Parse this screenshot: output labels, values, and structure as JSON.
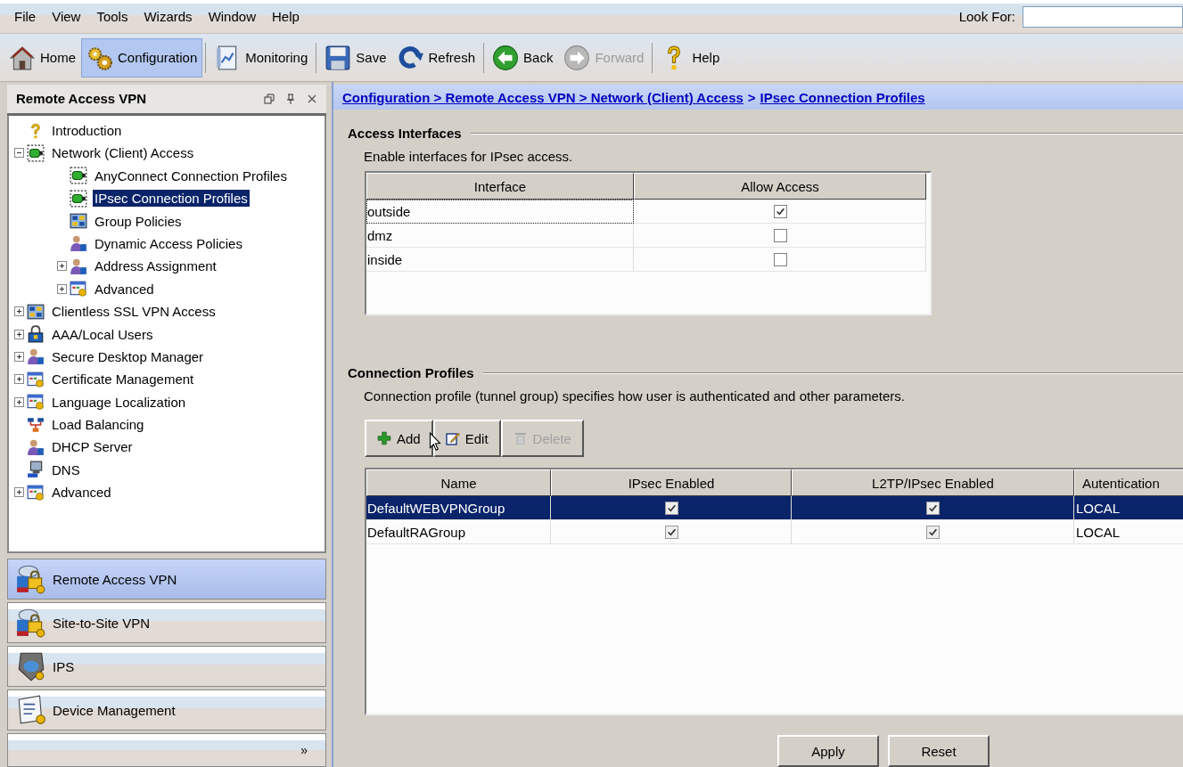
{
  "menu_bar": {
    "items": [
      "File",
      "View",
      "Tools",
      "Wizards",
      "Window",
      "Help"
    ],
    "look_for": {
      "label": "Look For:"
    }
  },
  "toolbar": {
    "groups": [
      [
        {
          "label": "Home",
          "selected": false,
          "disabled": false
        },
        {
          "label": "Configuration",
          "selected": true,
          "disabled": false
        }
      ],
      [
        {
          "label": "Monitoring",
          "selected": false,
          "disabled": false
        }
      ],
      [
        {
          "label": "Save",
          "selected": false,
          "disabled": false
        },
        {
          "label": "Refresh",
          "selected": false,
          "disabled": false
        }
      ],
      [
        {
          "label": "Back",
          "selected": false,
          "disabled": false
        },
        {
          "label": "Forward",
          "selected": false,
          "disabled": true
        }
      ],
      [
        {
          "label": "Help",
          "selected": false,
          "disabled": false
        }
      ]
    ]
  },
  "left_panel": {
    "title": "Remote Access VPN",
    "tree": [
      {
        "label": "Introduction",
        "selected": false
      },
      {
        "label": "Network (Client) Access",
        "selected": false,
        "expanded": true,
        "children": [
          {
            "label": "AnyConnect Connection Profiles",
            "selected": false
          },
          {
            "label": "IPsec Connection Profiles",
            "selected": true
          },
          {
            "label": "Group Policies",
            "selected": false
          },
          {
            "label": "Dynamic Access Policies",
            "selected": false
          },
          {
            "label": "Address Assignment",
            "selected": false,
            "expanded": false
          },
          {
            "label": "Advanced",
            "selected": false,
            "expanded": false
          }
        ]
      },
      {
        "label": "Clientless SSL VPN Access",
        "selected": false,
        "expanded": false
      },
      {
        "label": "AAA/Local Users",
        "selected": false,
        "expanded": false
      },
      {
        "label": "Secure Desktop Manager",
        "selected": false,
        "expanded": false
      },
      {
        "label": "Certificate Management",
        "selected": false,
        "expanded": false
      },
      {
        "label": "Language Localization",
        "selected": false,
        "expanded": false
      },
      {
        "label": "Load Balancing",
        "selected": false
      },
      {
        "label": "DHCP Server",
        "selected": false
      },
      {
        "label": "DNS",
        "selected": false
      },
      {
        "label": "Advanced",
        "selected": false,
        "expanded": false
      }
    ],
    "nav": [
      {
        "label": "Remote Access VPN",
        "selected": true
      },
      {
        "label": "Site-to-Site VPN",
        "selected": false
      },
      {
        "label": "IPS",
        "selected": false
      },
      {
        "label": "Device Management",
        "selected": false
      }
    ],
    "more": "»"
  },
  "content": {
    "breadcrumb": {
      "links": [
        "Configuration > Remote Access VPN > Network (Client) Access",
        "IPsec Connection Profiles"
      ],
      "separator": ">"
    },
    "access_interfaces": {
      "title": "Access Interfaces",
      "description": "Enable interfaces for IPsec access.",
      "columns": [
        "Interface",
        "Allow Access"
      ],
      "rows": [
        {
          "interface": "outside",
          "allow_access": true
        },
        {
          "interface": "dmz",
          "allow_access": false
        },
        {
          "interface": "inside",
          "allow_access": false
        }
      ]
    },
    "connection_profiles": {
      "title": "Connection Profiles",
      "description": "Connection profile (tunnel group) specifies how user is authenticated and other parameters.",
      "buttons": [
        {
          "label": "Add",
          "disabled": false
        },
        {
          "label": "Edit",
          "disabled": false
        },
        {
          "label": "Delete",
          "disabled": true
        }
      ],
      "columns": [
        "Name",
        "IPsec Enabled",
        "L2TP/IPsec Enabled",
        "Autentication"
      ],
      "rows": [
        {
          "name": "DefaultWEBVPNGroup",
          "ipsec_enabled": true,
          "l2tp_ipsec_enabled": true,
          "authentication": "LOCAL",
          "selected": true
        },
        {
          "name": "DefaultRAGroup",
          "ipsec_enabled": true,
          "l2tp_ipsec_enabled": true,
          "authentication": "LOCAL",
          "selected": false
        }
      ]
    },
    "actions": [
      "Apply",
      "Reset"
    ]
  }
}
